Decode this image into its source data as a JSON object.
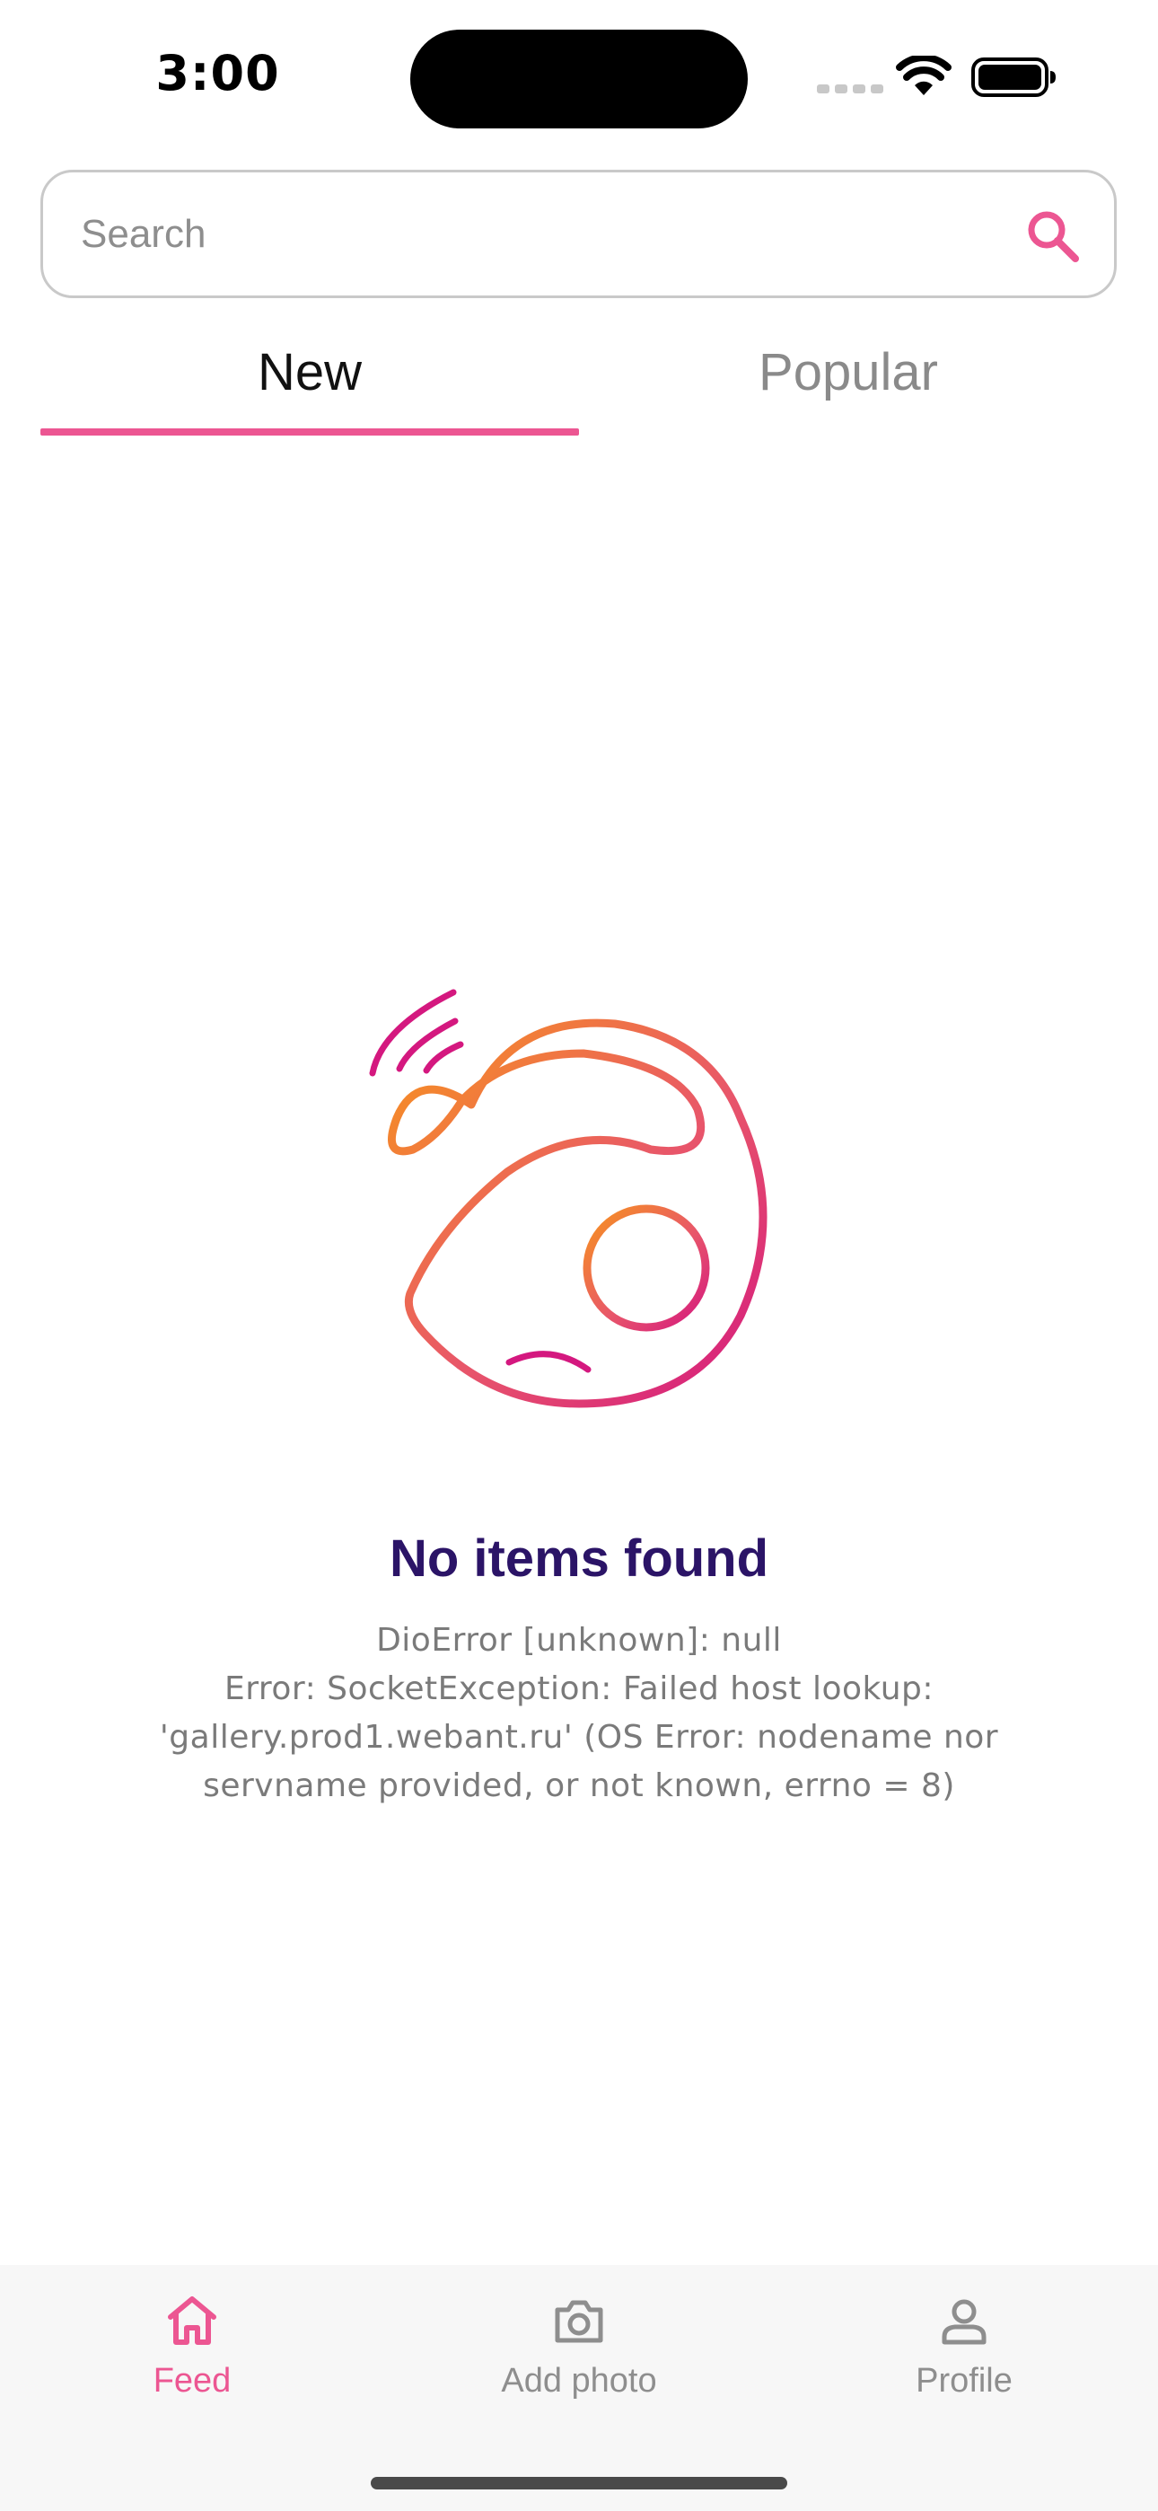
{
  "status_bar": {
    "time": "3:00",
    "icons": [
      "signal-icon",
      "wifi-icon",
      "battery-icon"
    ]
  },
  "search": {
    "placeholder": "Search",
    "value": "",
    "icon": "search-icon"
  },
  "tabs": [
    {
      "label": "New",
      "selected": true
    },
    {
      "label": "Popular",
      "selected": false
    }
  ],
  "empty_state": {
    "icon": "sad-orbit-illustration",
    "title": "No items found",
    "message": "DioError [unknown]: null\nError: SocketException: Failed host lookup: 'gallery.prod1.webant.ru' (OS Error: nodename nor servname provided, or not known, errno = 8)"
  },
  "bottom_nav": {
    "items": [
      {
        "label": "Feed",
        "icon": "home-icon",
        "active": true
      },
      {
        "label": "Add photo",
        "icon": "camera-icon",
        "active": false
      },
      {
        "label": "Profile",
        "icon": "user-icon",
        "active": false
      }
    ]
  },
  "colors": {
    "accent": "#ec5692",
    "title": "#2b1467",
    "inactive": "#8e8e8e",
    "gradient_start": "#f7941d",
    "gradient_end": "#d4187f"
  }
}
